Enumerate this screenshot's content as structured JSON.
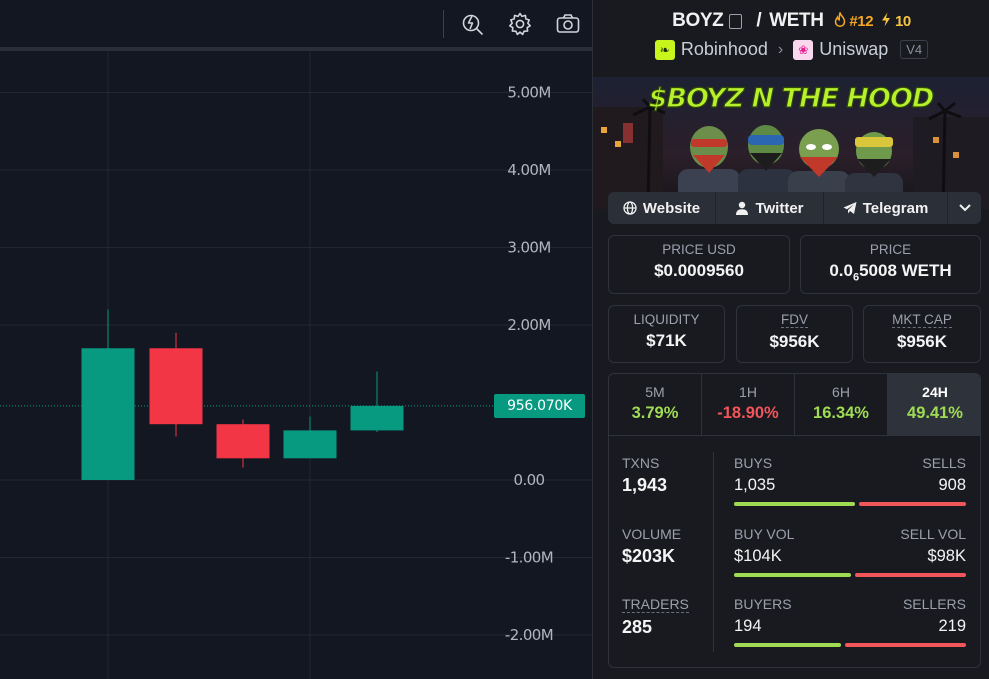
{
  "chart": {
    "price_axis_labels": [
      "5.00M",
      "4.00M",
      "3.00M",
      "2.00M",
      "0.00",
      "-1.00M",
      "-2.00M"
    ],
    "current_price_label": "956.070K",
    "colors": {
      "up": "#089981",
      "down": "#f23645",
      "grid": "#232733",
      "axis_text": "#b2b5be"
    }
  },
  "chart_data": {
    "type": "candlestick",
    "y_unit": "market cap (USD)",
    "ylim": [
      -2000000,
      5000000
    ],
    "y_ticks": [
      -2000000,
      -1000000,
      0,
      2000000,
      3000000,
      4000000,
      5000000
    ],
    "current_value": 956070,
    "candles": [
      {
        "open": 0,
        "high": 2200000,
        "low": 0,
        "close": 1700000
      },
      {
        "open": 1700000,
        "high": 1900000,
        "low": 560000,
        "close": 720000
      },
      {
        "open": 720000,
        "high": 780000,
        "low": 160000,
        "close": 280000
      },
      {
        "open": 280000,
        "high": 820000,
        "low": 280000,
        "close": 640000
      },
      {
        "open": 640000,
        "high": 1400000,
        "low": 620000,
        "close": 956070
      }
    ]
  },
  "pair": {
    "base": "BOYZ",
    "quote": "WETH",
    "separator": "/",
    "rank": "#12",
    "boosts": "10"
  },
  "chain": {
    "name": "Robinhood",
    "dex": "Uniswap",
    "version": "V4"
  },
  "banner": {
    "title": "$BOYZ N THE HOOD"
  },
  "socials": {
    "website": "Website",
    "twitter": "Twitter",
    "telegram": "Telegram"
  },
  "price": {
    "usd_label": "PRICE USD",
    "usd_value": "$0.0009560",
    "native_label": "PRICE",
    "native_prefix": "0.0",
    "native_subscript": "6",
    "native_digits": "5008 WETH"
  },
  "metrics": [
    {
      "label": "LIQUIDITY",
      "value": "$71K"
    },
    {
      "label": "FDV",
      "value": "$956K"
    },
    {
      "label": "MKT CAP",
      "value": "$956K"
    }
  ],
  "timeframes": [
    {
      "label": "5M",
      "change": "3.79%"
    },
    {
      "label": "1H",
      "change": "-18.90%"
    },
    {
      "label": "6H",
      "change": "16.34%"
    },
    {
      "label": "24H",
      "change": "49.41%"
    }
  ],
  "stats": {
    "txns": {
      "label": "TXNS",
      "value": "1,943"
    },
    "volume": {
      "label": "VOLUME",
      "value": "$203K"
    },
    "traders": {
      "label": "TRADERS",
      "value": "285"
    },
    "buys": {
      "label": "BUYS",
      "value": "1,035",
      "sells_label": "SELLS",
      "sells_value": "908",
      "buy_share": 0.53
    },
    "buy_vol": {
      "label": "BUY VOL",
      "value": "$104K",
      "sells_label": "SELL VOL",
      "sells_value": "$98K",
      "buy_share": 0.515
    },
    "buyers": {
      "label": "BUYERS",
      "value": "194",
      "sells_label": "SELLERS",
      "sells_value": "219",
      "buy_share": 0.47
    }
  }
}
